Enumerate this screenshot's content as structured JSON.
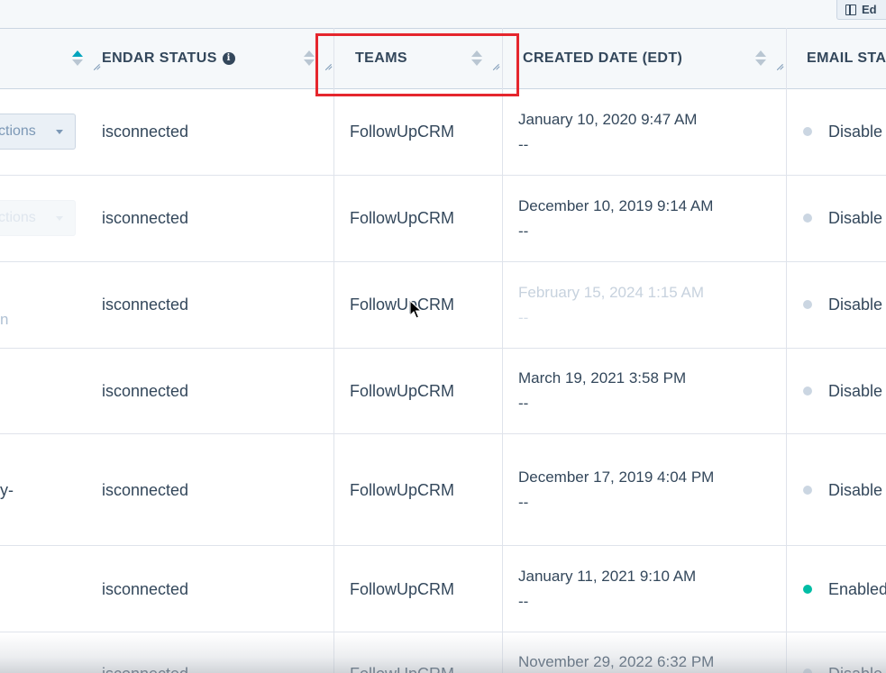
{
  "toolbar": {
    "edit_columns_label": "Ed"
  },
  "columns": {
    "calendar_status": "ENDAR STATUS",
    "teams": "TEAMS",
    "created_date": "CREATED DATE (EDT)",
    "email_status": "EMAIL STA"
  },
  "actions_label": "ctions",
  "rows": [
    {
      "left_fragment": "",
      "calendar": "isconnected",
      "team": "FollowUpCRM",
      "created": "January 10, 2020 9:47 AM",
      "created_sub": "--",
      "email": "Disable",
      "email_color": "#cbd6e2"
    },
    {
      "left_fragment": "",
      "calendar": "isconnected",
      "team": "FollowUpCRM",
      "created": "December 10, 2019 9:14 AM",
      "created_sub": "--",
      "email": "Disable",
      "email_color": "#cbd6e2"
    },
    {
      "left_fragment": "n",
      "calendar": "isconnected",
      "team": "FollowUpCRM",
      "created": "February 15, 2024 1:15 AM",
      "created_sub": "--",
      "email": "Disable",
      "email_color": "#cbd6e2"
    },
    {
      "left_fragment": "",
      "calendar": "isconnected",
      "team": "FollowUpCRM",
      "created": "March 19, 2021 3:58 PM",
      "created_sub": "--",
      "email": "Disable",
      "email_color": "#cbd6e2"
    },
    {
      "left_fragment": "y-",
      "calendar": "isconnected",
      "team": "FollowUpCRM",
      "created": "December 17, 2019 4:04 PM",
      "created_sub": "--",
      "email": "Disable",
      "email_color": "#cbd6e2"
    },
    {
      "left_fragment": "",
      "calendar": "isconnected",
      "team": "FollowUpCRM",
      "created": "January 11, 2021 9:10 AM",
      "created_sub": "--",
      "email": "Enabled",
      "email_color": "#00bda5"
    },
    {
      "left_fragment": "",
      "calendar": "isconnected",
      "team": "FollowUpCRM",
      "created": "November 29, 2022 6:32 PM",
      "created_sub": "",
      "email": "Disable",
      "email_color": "#cbd6e2"
    }
  ]
}
